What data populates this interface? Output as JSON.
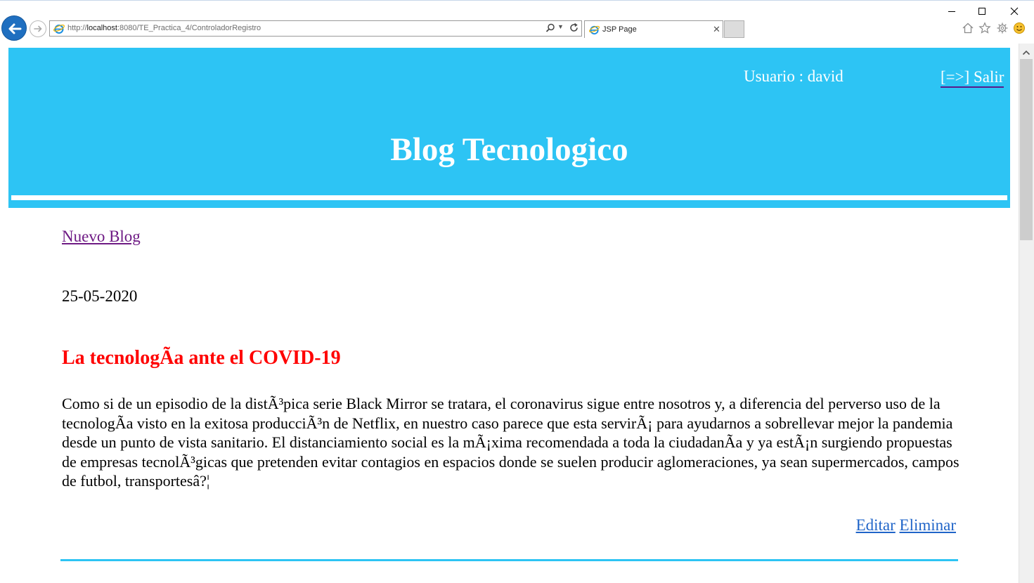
{
  "browser": {
    "url_prefix": "http://",
    "url_host": "localhost",
    "url_rest": ":8080/TE_Practica_4/ControladorRegistro",
    "tab_title": "JSP Page",
    "icons": [
      "back-arrow-icon",
      "forward-arrow-icon",
      "ie-icon",
      "search-icon",
      "refresh-icon",
      "home-icon",
      "star-icon",
      "gear-icon",
      "smiley-icon",
      "minimize-icon",
      "maximize-icon",
      "close-icon"
    ]
  },
  "header": {
    "user_label": "Usuario : david",
    "logout_label": "[=>] Salir",
    "site_title": "Blog Tecnologico",
    "background_color": "#2dc4f4"
  },
  "main": {
    "new_blog_label": "Nuevo Blog",
    "post": {
      "date": "25-05-2020",
      "title": "La tecnologÃa ante el COVID-19",
      "title_color": "#ff0000",
      "body": "Como si de un episodio de la distÃ³pica serie Black Mirror se tratara, el coronavirus sigue entre nosotros y, a diferencia del perverso uso de la tecnologÃa visto en la exitosa producciÃ³n de Netflix, en nuestro caso parece que esta servirÃ¡ para ayudarnos a sobrellevar mejor la pandemia desde un punto de vista sanitario. El distanciamiento social es la mÃ¡xima recomendada a toda la ciudadanÃa y ya estÃ¡n surgiendo propuestas de empresas tecnolÃ³gicas que pretenden evitar contagios en espacios donde se suelen producir aglomeraciones, ya sean supermercados, campos de futbol, transportesâ?¦",
      "edit_label": "Editar",
      "delete_label": "Eliminar"
    }
  }
}
